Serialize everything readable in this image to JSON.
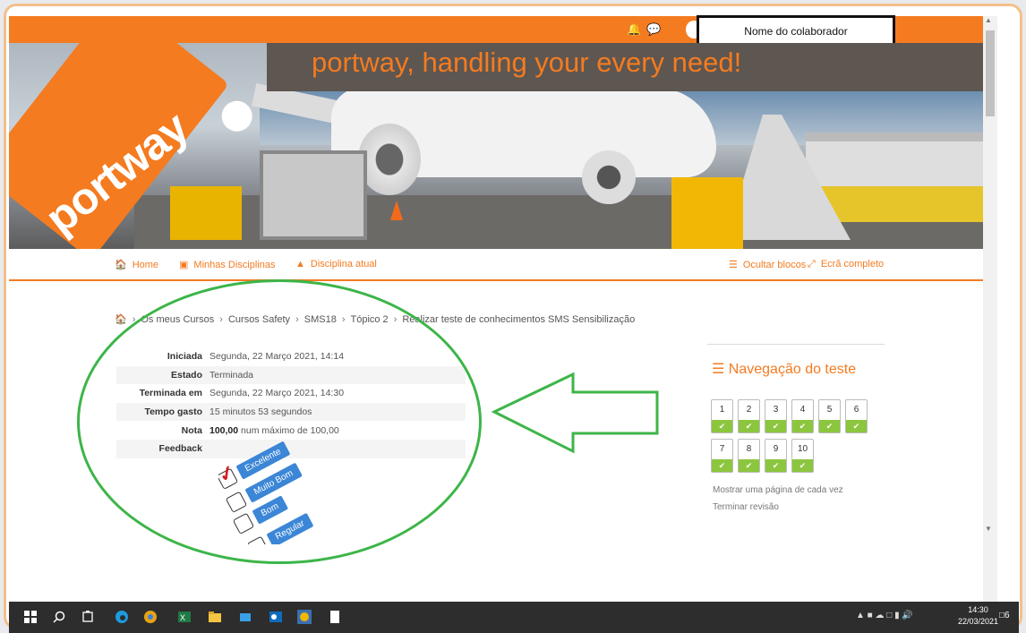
{
  "header": {
    "user_name": "Nome do colaborador",
    "banner_slogan": "portway, handling your every need!",
    "logo_text": "portway"
  },
  "nav": {
    "home": "Home",
    "my_courses": "Minhas Disciplinas",
    "current_course": "Disciplina atual",
    "hide_blocks": "Ocultar blocos",
    "fullscreen": "Ecrã completo"
  },
  "breadcrumb": [
    "Os meus Cursos",
    "Cursos Safety",
    "SMS18",
    "Tópico 2",
    "Realizar teste de conhecimentos SMS Sensibilização"
  ],
  "summary": {
    "rows": [
      {
        "label": "Iniciada",
        "value": "Segunda, 22 Março 2021, 14:14"
      },
      {
        "label": "Estado",
        "value": "Terminada"
      },
      {
        "label": "Terminada em",
        "value": "Segunda, 22 Março 2021, 14:30"
      },
      {
        "label": "Tempo gasto",
        "value": "15 minutos 53 segundos"
      }
    ],
    "grade_label": "Nota",
    "grade_value": "100,00",
    "grade_suffix": " num máximo de 100,00",
    "feedback_label": "Feedback",
    "feedback_options": [
      "Excelente",
      "Muito Bom",
      "Bom",
      "Regular"
    ],
    "feedback_checked": "Excelente"
  },
  "quiz_nav": {
    "title": "Navegação do teste",
    "questions": [
      "1",
      "2",
      "3",
      "4",
      "5",
      "6",
      "7",
      "8",
      "9",
      "10"
    ],
    "show_one_page": "Mostrar uma página de cada vez",
    "finish_review": "Terminar revisão"
  },
  "taskbar": {
    "time": "14:30",
    "date": "22/03/2021",
    "notifications": "6"
  },
  "colors": {
    "brand_orange": "#f47b20",
    "annotation_green": "#3db549",
    "correct_green": "#8cc63f",
    "feedback_blue": "#3b86d6"
  }
}
